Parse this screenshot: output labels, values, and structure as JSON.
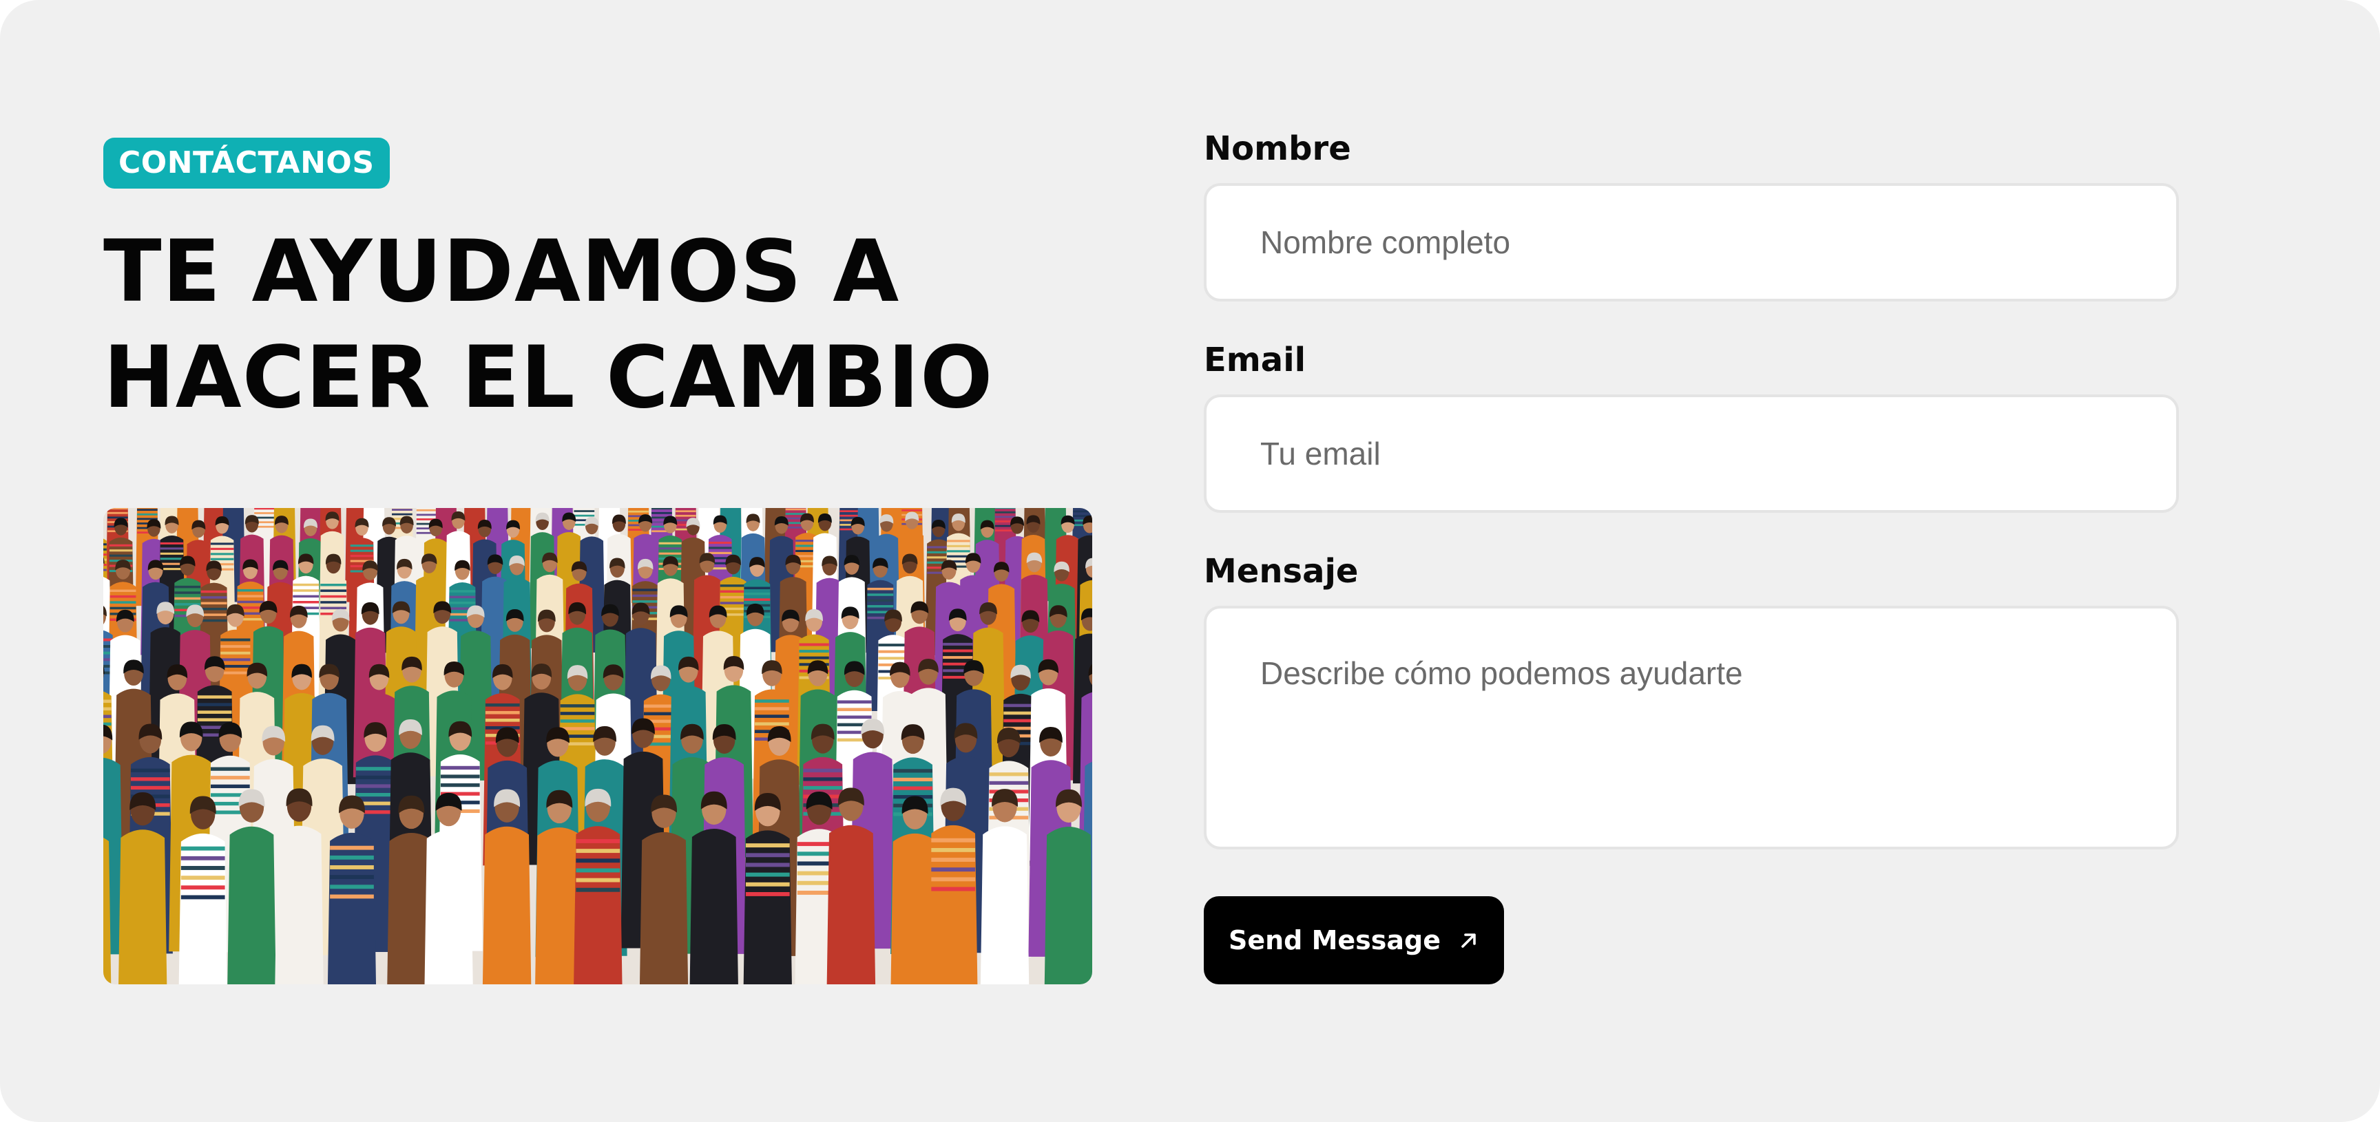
{
  "badge": "CONTÁCTANOS",
  "heading": {
    "line1": "TE AYUDAMOS A",
    "line2": "HACER EL CAMBIO"
  },
  "image": {
    "name": "crowd-photo"
  },
  "form": {
    "name": {
      "label": "Nombre",
      "placeholder": "Nombre completo",
      "value": ""
    },
    "email": {
      "label": "Email",
      "placeholder": "Tu email",
      "value": ""
    },
    "message": {
      "label": "Mensaje",
      "placeholder": "Describe cómo podemos ayudarte",
      "value": ""
    },
    "submit": {
      "label": "Send Message",
      "icon": "arrow-up-right-icon"
    }
  },
  "colors": {
    "background": "#f0f0f0",
    "badge": "#0fb0b4",
    "button": "#000000",
    "heading": "#050505"
  }
}
